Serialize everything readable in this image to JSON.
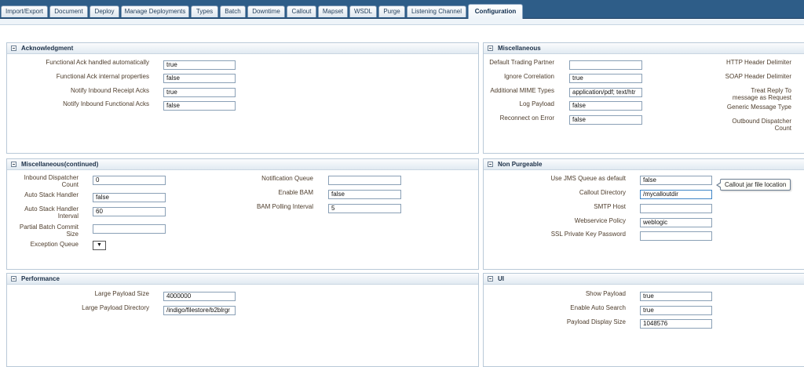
{
  "tabs": [
    "Import/Export",
    "Document",
    "Deploy",
    "Manage Deployments",
    "Types",
    "Batch",
    "Downtime",
    "Callout",
    "Mapset",
    "WSDL",
    "Purge",
    "Listening Channel",
    "Configuration"
  ],
  "active_tab": "Configuration",
  "acknowledgment": {
    "title": "Acknowledgment",
    "functional_ack_auto_label": "Functional Ack handled automatically",
    "functional_ack_auto_value": "true",
    "functional_ack_internal_label": "Functional Ack internal properties",
    "functional_ack_internal_value": "false",
    "notify_receipt_label": "Notify Inbound Receipt Acks",
    "notify_receipt_value": "true",
    "notify_functional_label": "Notify Inbound Functional Acks",
    "notify_functional_value": "false"
  },
  "misc": {
    "title": "Miscellaneous",
    "default_partner_label": "Default Trading Partner",
    "default_partner_value": "",
    "ignore_correlation_label": "Ignore Correlation",
    "ignore_correlation_value": "true",
    "mime_label": "Additional MIME Types",
    "mime_value": "application/pdf; text/htr",
    "log_payload_label": "Log Payload",
    "log_payload_value": "false",
    "reconnect_label": "Reconnect on Error",
    "reconnect_value": "false",
    "http_header_label": "HTTP Header Delimiter",
    "soap_header_label": "SOAP Header Delimiter",
    "treat_reply_line1": "Treat Reply To",
    "treat_reply_line2": "message as Request",
    "generic_type_label": "Generic Message Type",
    "outbound_count_line1": "Outbound Dispatcher",
    "outbound_count_line2": "Count"
  },
  "misc_cont": {
    "title": "Miscellaneous(continued)",
    "inbound_count_line1": "Inbound Dispatcher",
    "inbound_count_line2": "Count",
    "inbound_count_value": "0",
    "auto_stack_label": "Auto Stack Handler",
    "auto_stack_value": "false",
    "auto_stack_interval_line1": "Auto Stack Handler",
    "auto_stack_interval_line2": "Interval",
    "auto_stack_interval_value": "60",
    "partial_batch_line1": "Partial Batch Commit",
    "partial_batch_line2": "Size",
    "partial_batch_value": "",
    "exception_queue_label": "Exception Queue",
    "exception_queue_arrow": "▼",
    "notification_queue_label": "Notification Queue",
    "notification_queue_value": "",
    "enable_bam_label": "Enable BAM",
    "enable_bam_value": "false",
    "bam_polling_label": "BAM Polling Interval",
    "bam_polling_value": "5"
  },
  "non_purgeable": {
    "title": "Non Purgeable",
    "jms_label": "Use JMS Queue as default",
    "jms_value": "false",
    "callout_dir_label": "Callout Directory",
    "callout_dir_value": "/mycalloutdir",
    "callout_tooltip": "Callout jar file location",
    "smtp_label": "SMTP Host",
    "smtp_value": "",
    "ws_policy_label": "Webservice Policy",
    "ws_policy_value": "weblogic",
    "ssl_label": "SSL Private Key Password",
    "ssl_value": ""
  },
  "performance": {
    "title": "Performance",
    "large_payload_size_label": "Large Payload Size",
    "large_payload_size_value": "4000000",
    "large_payload_dir_label": "Large Payload Directory",
    "large_payload_dir_value": "/indigo/filestore/b2blrgr"
  },
  "ui": {
    "title": "UI",
    "show_payload_label": "Show Payload",
    "show_payload_value": "true",
    "auto_search_label": "Enable Auto Search",
    "auto_search_value": "true",
    "display_size_label": "Payload Display Size",
    "display_size_value": "1048576"
  }
}
